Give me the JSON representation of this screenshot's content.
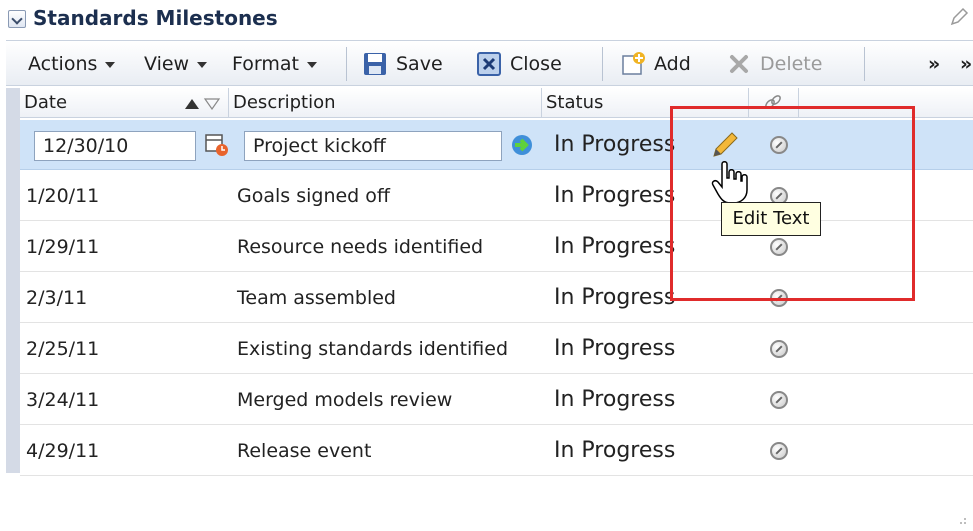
{
  "panel": {
    "title": "Standards Milestones"
  },
  "toolbar": {
    "actions_label": "Actions",
    "view_label": "View",
    "format_label": "Format",
    "save_label": "Save",
    "close_label": "Close",
    "add_label": "Add",
    "delete_label": "Delete",
    "overflow_label": "»"
  },
  "grid": {
    "columns": {
      "date": "Date",
      "description": "Description",
      "status": "Status"
    },
    "rows": [
      {
        "date": "12/30/10",
        "description": "Project kickoff",
        "status": "In Progress"
      },
      {
        "date": "1/20/11",
        "description": "Goals signed off",
        "status": "In Progress"
      },
      {
        "date": "1/29/11",
        "description": "Resource needs identified",
        "status": "In Progress"
      },
      {
        "date": "2/3/11",
        "description": "Team assembled",
        "status": "In Progress"
      },
      {
        "date": "2/25/11",
        "description": "Existing standards identified",
        "status": "In Progress"
      },
      {
        "date": "3/24/11",
        "description": "Merged models review",
        "status": "In Progress"
      },
      {
        "date": "4/29/11",
        "description": "Release event",
        "status": "In Progress"
      }
    ]
  },
  "tooltip": {
    "text": "Edit Text"
  },
  "icons": {
    "collapse": "chevron-down-icon",
    "edit_corner": "pencil-icon",
    "save": "floppy-disk-icon",
    "close": "close-box-icon",
    "add": "add-record-icon",
    "delete": "delete-x-icon",
    "calendar": "calendar-clock-icon",
    "go": "green-arrow-icon",
    "edit": "pencil-icon",
    "link": "link-icon",
    "cursor": "hand-pointer-icon"
  },
  "colors": {
    "selected_row": "#cfe3f8",
    "highlight_box": "#e02b2b",
    "tooltip_bg": "#ffffe1",
    "title": "#1c2f4f"
  }
}
